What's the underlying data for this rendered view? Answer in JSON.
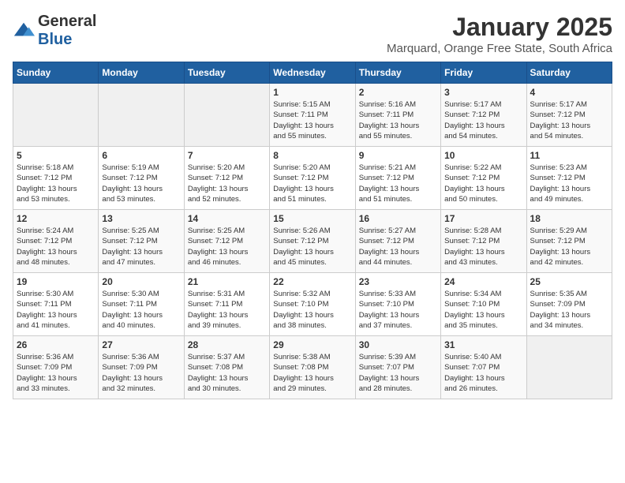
{
  "logo": {
    "text_general": "General",
    "text_blue": "Blue"
  },
  "header": {
    "month_year": "January 2025",
    "subtitle": "Marquard, Orange Free State, South Africa"
  },
  "weekdays": [
    "Sunday",
    "Monday",
    "Tuesday",
    "Wednesday",
    "Thursday",
    "Friday",
    "Saturday"
  ],
  "weeks": [
    [
      {
        "day": "",
        "info": ""
      },
      {
        "day": "",
        "info": ""
      },
      {
        "day": "",
        "info": ""
      },
      {
        "day": "1",
        "info": "Sunrise: 5:15 AM\nSunset: 7:11 PM\nDaylight: 13 hours\nand 55 minutes."
      },
      {
        "day": "2",
        "info": "Sunrise: 5:16 AM\nSunset: 7:11 PM\nDaylight: 13 hours\nand 55 minutes."
      },
      {
        "day": "3",
        "info": "Sunrise: 5:17 AM\nSunset: 7:12 PM\nDaylight: 13 hours\nand 54 minutes."
      },
      {
        "day": "4",
        "info": "Sunrise: 5:17 AM\nSunset: 7:12 PM\nDaylight: 13 hours\nand 54 minutes."
      }
    ],
    [
      {
        "day": "5",
        "info": "Sunrise: 5:18 AM\nSunset: 7:12 PM\nDaylight: 13 hours\nand 53 minutes."
      },
      {
        "day": "6",
        "info": "Sunrise: 5:19 AM\nSunset: 7:12 PM\nDaylight: 13 hours\nand 53 minutes."
      },
      {
        "day": "7",
        "info": "Sunrise: 5:20 AM\nSunset: 7:12 PM\nDaylight: 13 hours\nand 52 minutes."
      },
      {
        "day": "8",
        "info": "Sunrise: 5:20 AM\nSunset: 7:12 PM\nDaylight: 13 hours\nand 51 minutes."
      },
      {
        "day": "9",
        "info": "Sunrise: 5:21 AM\nSunset: 7:12 PM\nDaylight: 13 hours\nand 51 minutes."
      },
      {
        "day": "10",
        "info": "Sunrise: 5:22 AM\nSunset: 7:12 PM\nDaylight: 13 hours\nand 50 minutes."
      },
      {
        "day": "11",
        "info": "Sunrise: 5:23 AM\nSunset: 7:12 PM\nDaylight: 13 hours\nand 49 minutes."
      }
    ],
    [
      {
        "day": "12",
        "info": "Sunrise: 5:24 AM\nSunset: 7:12 PM\nDaylight: 13 hours\nand 48 minutes."
      },
      {
        "day": "13",
        "info": "Sunrise: 5:25 AM\nSunset: 7:12 PM\nDaylight: 13 hours\nand 47 minutes."
      },
      {
        "day": "14",
        "info": "Sunrise: 5:25 AM\nSunset: 7:12 PM\nDaylight: 13 hours\nand 46 minutes."
      },
      {
        "day": "15",
        "info": "Sunrise: 5:26 AM\nSunset: 7:12 PM\nDaylight: 13 hours\nand 45 minutes."
      },
      {
        "day": "16",
        "info": "Sunrise: 5:27 AM\nSunset: 7:12 PM\nDaylight: 13 hours\nand 44 minutes."
      },
      {
        "day": "17",
        "info": "Sunrise: 5:28 AM\nSunset: 7:12 PM\nDaylight: 13 hours\nand 43 minutes."
      },
      {
        "day": "18",
        "info": "Sunrise: 5:29 AM\nSunset: 7:12 PM\nDaylight: 13 hours\nand 42 minutes."
      }
    ],
    [
      {
        "day": "19",
        "info": "Sunrise: 5:30 AM\nSunset: 7:11 PM\nDaylight: 13 hours\nand 41 minutes."
      },
      {
        "day": "20",
        "info": "Sunrise: 5:30 AM\nSunset: 7:11 PM\nDaylight: 13 hours\nand 40 minutes."
      },
      {
        "day": "21",
        "info": "Sunrise: 5:31 AM\nSunset: 7:11 PM\nDaylight: 13 hours\nand 39 minutes."
      },
      {
        "day": "22",
        "info": "Sunrise: 5:32 AM\nSunset: 7:10 PM\nDaylight: 13 hours\nand 38 minutes."
      },
      {
        "day": "23",
        "info": "Sunrise: 5:33 AM\nSunset: 7:10 PM\nDaylight: 13 hours\nand 37 minutes."
      },
      {
        "day": "24",
        "info": "Sunrise: 5:34 AM\nSunset: 7:10 PM\nDaylight: 13 hours\nand 35 minutes."
      },
      {
        "day": "25",
        "info": "Sunrise: 5:35 AM\nSunset: 7:09 PM\nDaylight: 13 hours\nand 34 minutes."
      }
    ],
    [
      {
        "day": "26",
        "info": "Sunrise: 5:36 AM\nSunset: 7:09 PM\nDaylight: 13 hours\nand 33 minutes."
      },
      {
        "day": "27",
        "info": "Sunrise: 5:36 AM\nSunset: 7:09 PM\nDaylight: 13 hours\nand 32 minutes."
      },
      {
        "day": "28",
        "info": "Sunrise: 5:37 AM\nSunset: 7:08 PM\nDaylight: 13 hours\nand 30 minutes."
      },
      {
        "day": "29",
        "info": "Sunrise: 5:38 AM\nSunset: 7:08 PM\nDaylight: 13 hours\nand 29 minutes."
      },
      {
        "day": "30",
        "info": "Sunrise: 5:39 AM\nSunset: 7:07 PM\nDaylight: 13 hours\nand 28 minutes."
      },
      {
        "day": "31",
        "info": "Sunrise: 5:40 AM\nSunset: 7:07 PM\nDaylight: 13 hours\nand 26 minutes."
      },
      {
        "day": "",
        "info": ""
      }
    ]
  ]
}
